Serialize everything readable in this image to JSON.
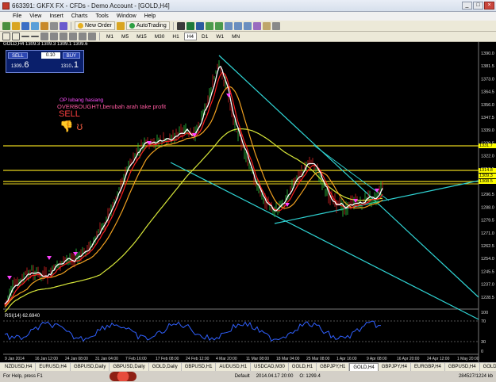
{
  "window": {
    "title": "663391: GKFX FX - CFDs - Demo Account - [GOLD,H4]"
  },
  "menu": [
    "File",
    "View",
    "Insert",
    "Charts",
    "Tools",
    "Window",
    "Help"
  ],
  "toolbar": {
    "new_order_label": "New Order",
    "autotrading_label": "AutoTrading",
    "timeframes": [
      "M1",
      "M5",
      "M15",
      "M30",
      "H1",
      "H4",
      "D1",
      "W1",
      "MN"
    ]
  },
  "chart": {
    "header": "GOLD,H4  1309.3 1309.3 1309.1 1309.6",
    "trade_panel": {
      "sell_label": "SELL",
      "buy_label": "BUY",
      "lot": "0.10",
      "sell_price_small": "1309",
      "sell_price_big": ".6",
      "buy_price_small": "1310",
      "buy_price_big": ".1"
    },
    "annotations": {
      "note1": "OP lubang hasiang",
      "note2": "OVERBOUGHT!,berubah arah take profit",
      "note3": "SELL"
    },
    "rsi_label": "RSI(14) 62.6940",
    "price_axis": [
      "1390.0",
      "1381.5",
      "1373.0",
      "1364.5",
      "1356.0",
      "1347.5",
      "1339.0",
      "1330.5",
      "1322.0",
      "1313.5",
      "1305.0",
      "1296.5",
      "1288.0",
      "1279.5",
      "1271.0",
      "1262.5",
      "1254.0",
      "1245.5",
      "1237.0",
      "1228.5"
    ],
    "price_tags": [
      "1331.7",
      "1314.8",
      "1309.3",
      "1308.5"
    ],
    "rsi_axis": [
      "100",
      "70",
      "30",
      "0"
    ],
    "date_axis": [
      "9 Jan 2014",
      "16 Jan 12:00",
      "24 Jan 08:00",
      "31 Jan 04:00",
      "7 Feb 16:00",
      "17 Feb 08:00",
      "24 Feb 12:00",
      "4 Mar 20:00",
      "11 Mar 08:00",
      "18 Mar 04:00",
      "25 Mar 08:00",
      "1 Apr 16:00",
      "9 Apr 08:00",
      "16 Apr 20:00",
      "24 Apr 12:00",
      "1 May 20:00"
    ]
  },
  "tabs": [
    "NZDUSD,H4",
    "EURUSD,H4",
    "GBPUSD,Daily",
    "GBPUSD,Daily",
    "GOLD,Daily",
    "GBPUSD,H1",
    "AUDUSD,H1",
    "USDCAD,M30",
    "GOLD,H1",
    "GBPJPY,H1",
    "GOLD,H4",
    "GBPJPY,H4",
    "EURGBP,H4",
    "GBPUSD,H4",
    "GOLD,H4"
  ],
  "active_tab": "GOLD,H4",
  "status": {
    "help": "For Help, press F1",
    "profile": "Default",
    "datetime": "2014.04.17 20:00",
    "extra": "O: 1299.4",
    "bars": "284527/1224 kb"
  }
}
